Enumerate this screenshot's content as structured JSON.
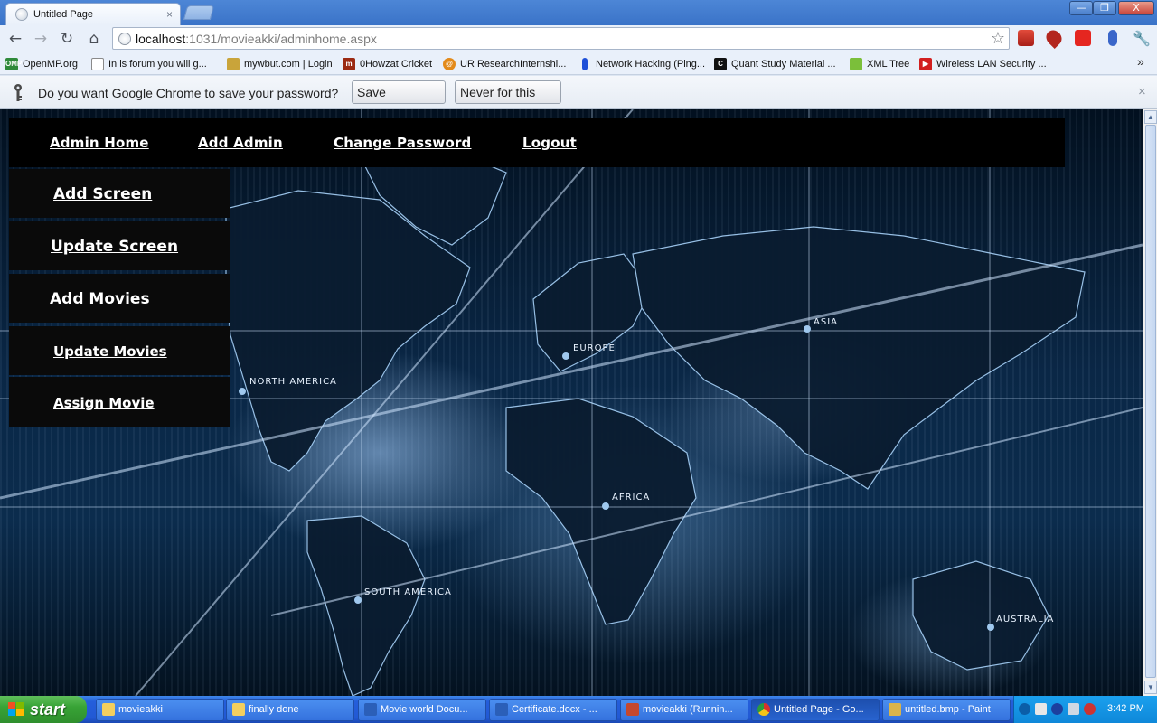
{
  "browser": {
    "tab_title": "Untitled Page",
    "tab_close": "×",
    "url_host": "localhost",
    "url_path": ":1031/movieakki/adminhome.aspx",
    "window_buttons": {
      "minimize": "—",
      "maximize": "❐",
      "close": "X"
    }
  },
  "bookmarks": [
    {
      "label": "OpenMP.org",
      "icon": "openmp-icon",
      "color": "#2f8a3a"
    },
    {
      "label": "In  is forum you will g...",
      "icon": "page-icon",
      "color": "#8a8a8a"
    },
    {
      "label": "mywbut.com | Login",
      "icon": "mywbut-icon",
      "color": "#c9a43a"
    },
    {
      "label": "0Howzat Cricket",
      "icon": "howzat-icon",
      "color": "#9b2a12"
    },
    {
      "label": "UR ResearchInternshi...",
      "icon": "ur-icon",
      "color": "#e38a1a"
    },
    {
      "label": "Network Hacking (Ping...",
      "icon": "pin-icon",
      "color": "#1d4fd8"
    },
    {
      "label": "Quant Study Material ...",
      "icon": "quant-icon",
      "color": "#111111"
    },
    {
      "label": "XML Tree",
      "icon": "xml-icon",
      "color": "#7bbf3a"
    },
    {
      "label": "Wireless LAN Security ...",
      "icon": "youtube-icon",
      "color": "#d21f1f"
    }
  ],
  "bookmarks_overflow": "»",
  "infobar": {
    "message": "Do you want Google Chrome to save your password?",
    "save_label": "Save password",
    "never_label": "Never for this site",
    "close": "×"
  },
  "page": {
    "topnav": [
      "Admin Home",
      "Add Admin",
      "Change Password",
      "Logout"
    ],
    "sidenav": [
      "Add Screen",
      "Update Screen",
      "Add Movies",
      "Update Movies",
      "Assign Movie"
    ],
    "map_labels": [
      "NORTH AMERICA",
      "EUROPE",
      "ASIA",
      "AFRICA",
      "SOUTH AMERICA",
      "AUSTRALIA"
    ]
  },
  "taskbar": {
    "start_label": "start",
    "tasks": [
      "movieakki",
      "finally done",
      "Movie world Docu...",
      "Certificate.docx - ...",
      "movieakki (Runnin...",
      "Untitled Page - Go...",
      "untitled.bmp - Paint"
    ],
    "clock": "3:42 PM"
  }
}
